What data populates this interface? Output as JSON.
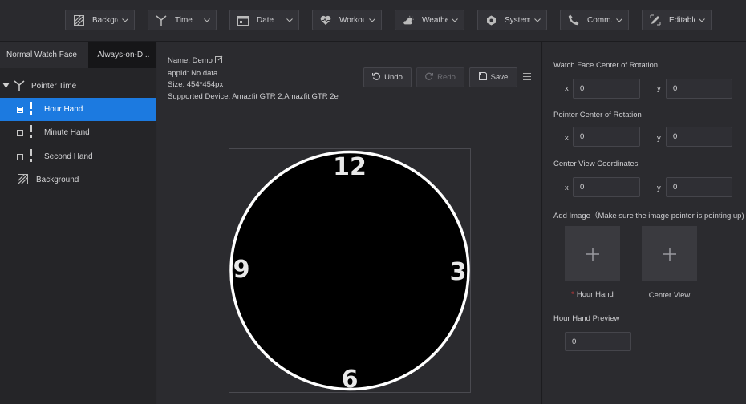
{
  "toolbar": {
    "items": [
      {
        "label": "Backgro...",
        "icon": "background-icon"
      },
      {
        "label": "Time",
        "icon": "pointer-icon"
      },
      {
        "label": "Date",
        "icon": "calendar-icon"
      },
      {
        "label": "Workou...",
        "icon": "heart-icon"
      },
      {
        "label": "Weather",
        "icon": "weather-icon"
      },
      {
        "label": "System",
        "icon": "system-icon"
      },
      {
        "label": "Comm...",
        "icon": "phone-icon"
      },
      {
        "label": "Editable",
        "icon": "edit-icon"
      }
    ]
  },
  "tabs": {
    "normal": "Normal Watch Face",
    "aod": "Always-on-D..."
  },
  "tree": {
    "pointer_time": "Pointer Time",
    "hour_hand": "Hour Hand",
    "minute_hand": "Minute Hand",
    "second_hand": "Second Hand",
    "background": "Background"
  },
  "info": {
    "name_label": "Name:",
    "name_value": "Demo",
    "appid_label": "appId:",
    "appid_value": "No data",
    "size_label": "Size:",
    "size_value": "454*454px",
    "device_label": "Supported Device:",
    "device_value": "Amazfit GTR 2,Amazfit GTR 2e"
  },
  "actions": {
    "undo": "Undo",
    "redo": "Redo",
    "save": "Save"
  },
  "dial": {
    "n12": "12",
    "n3": "3",
    "n6": "6",
    "n9": "9"
  },
  "panel": {
    "face_center": "Watch Face Center of Rotation",
    "pointer_center": "Pointer Center of Rotation",
    "center_view": "Center View Coordinates",
    "x": "x",
    "y": "y",
    "face_x": "0",
    "face_y": "0",
    "pointer_x": "0",
    "pointer_y": "0",
    "view_x": "0",
    "view_y": "0",
    "add_image": "Add Image（Make sure the image pointer is pointing up)",
    "hour_hand_label": "Hour Hand",
    "center_view_label": "Center View",
    "preview_label": "Hour Hand Preview",
    "preview_value": "0"
  }
}
